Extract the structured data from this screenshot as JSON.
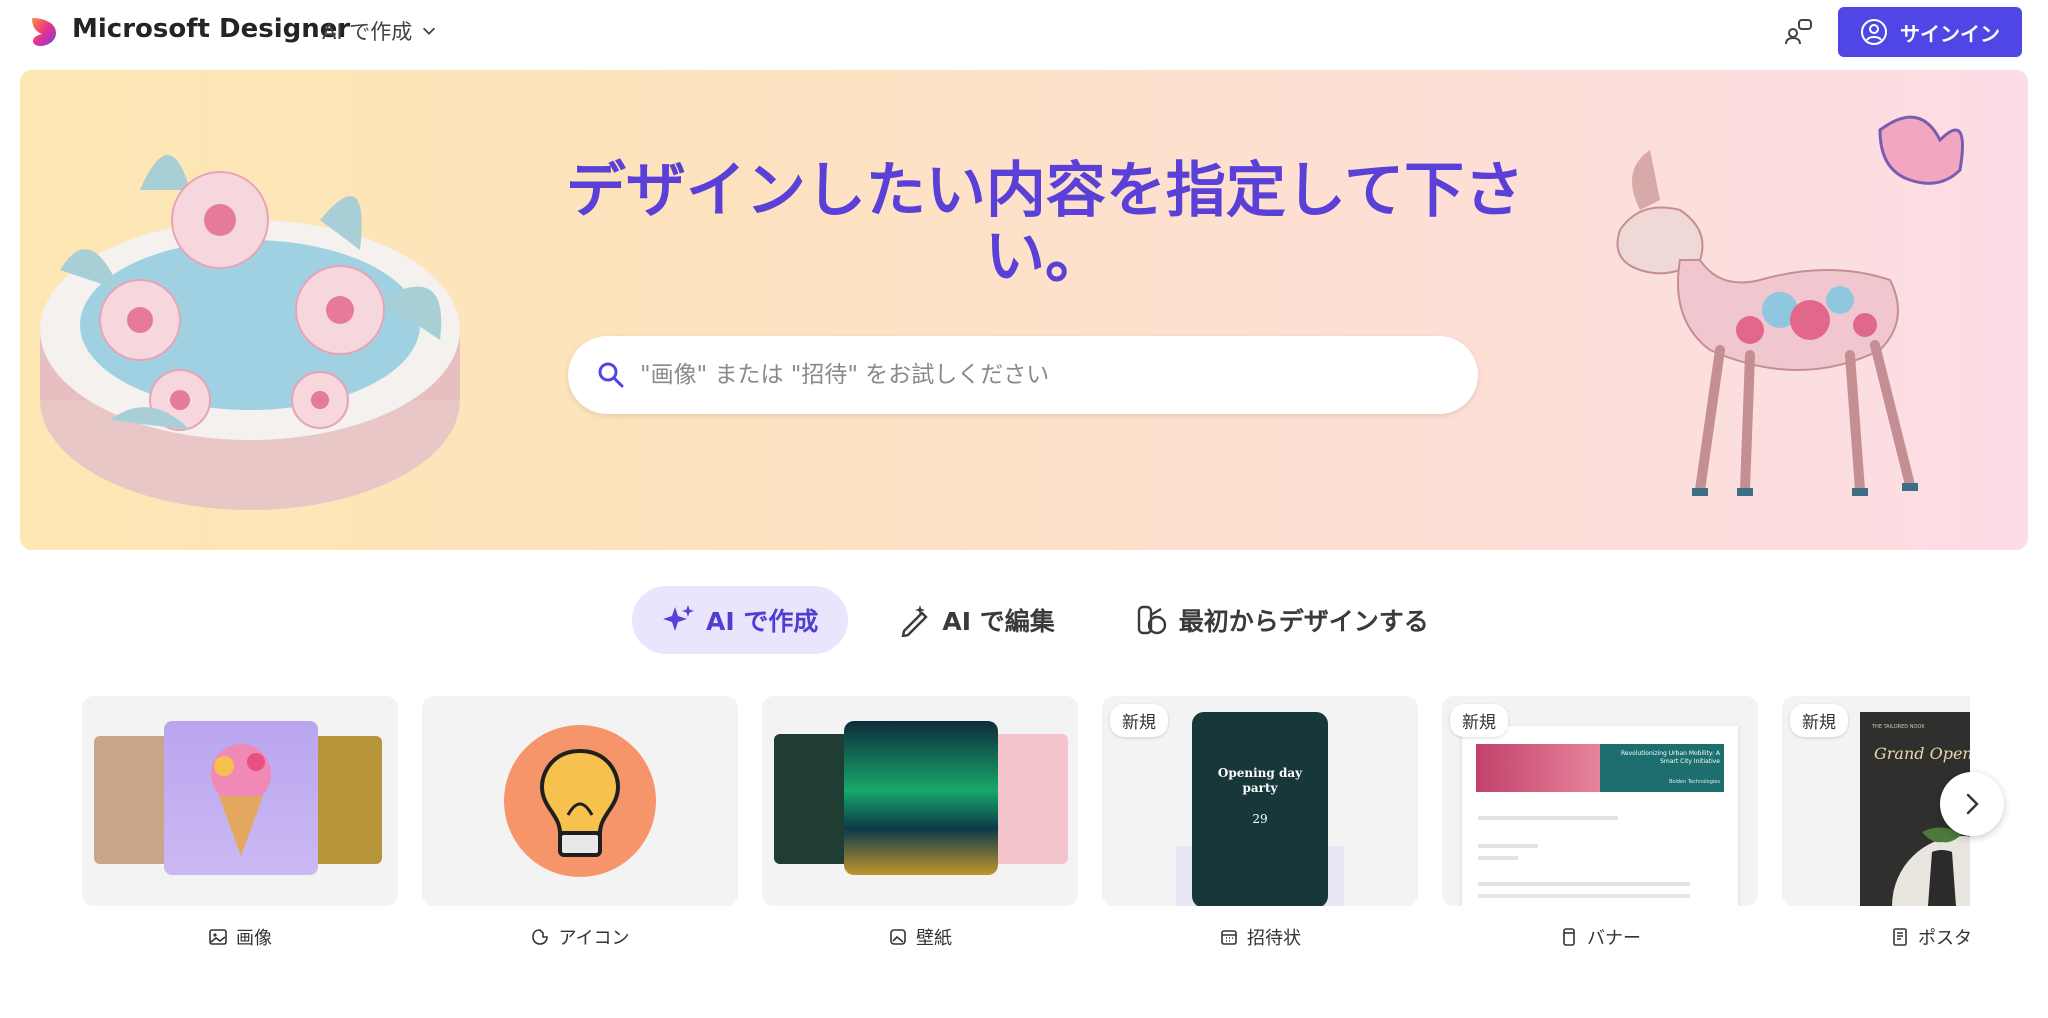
{
  "header": {
    "brand": "Microsoft Designer",
    "ai_menu_label": "AI で作成",
    "signin_label": "サインイン"
  },
  "hero": {
    "title": "デザインしたい内容を指定して下さい。",
    "search_placeholder": "\"画像\" または \"招待\" をお試しください"
  },
  "tabs": [
    {
      "label": "AI で作成",
      "icon": "sparkle-icon",
      "active": true
    },
    {
      "label": "AI で編集",
      "icon": "magic-pen-icon",
      "active": false
    },
    {
      "label": "最初からデザインする",
      "icon": "design-tools-icon",
      "active": false
    }
  ],
  "cards": [
    {
      "label": "画像",
      "icon": "image-icon",
      "badge": ""
    },
    {
      "label": "アイコン",
      "icon": "icon-sticker-icon",
      "badge": ""
    },
    {
      "label": "壁紙",
      "icon": "wallpaper-icon",
      "badge": ""
    },
    {
      "label": "招待状",
      "icon": "calendar-icon",
      "badge": "新規",
      "thumb": {
        "title": "Opening day party",
        "date": "29"
      }
    },
    {
      "label": "バナー",
      "icon": "banner-icon",
      "badge": "新規",
      "thumb": {
        "title": "Revolutionizing Urban Mobility: A Smart City Initiative",
        "sub": "Bolden Technologies"
      }
    },
    {
      "label": "ポスタ",
      "icon": "poster-icon",
      "badge": "新規",
      "thumb": {
        "title": "Grand Openin",
        "sub": "THE TAILORED NOOK"
      }
    }
  ],
  "colors": {
    "accent": "#4f46e5",
    "hero_title": "#5a40d6",
    "active_tab_bg": "#ebe4fd"
  }
}
